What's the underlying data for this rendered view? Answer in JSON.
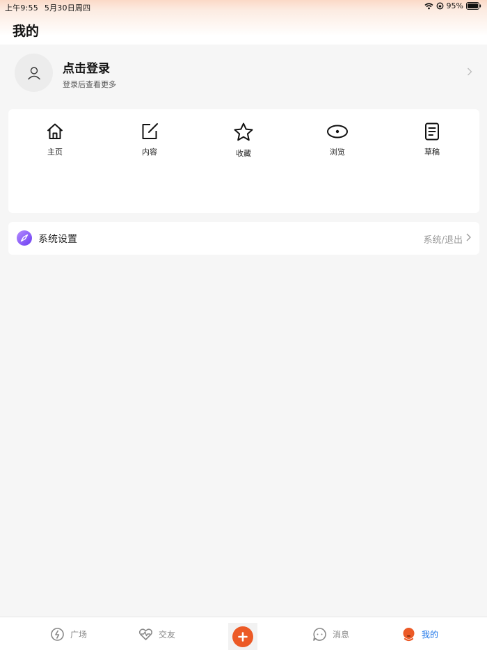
{
  "status_bar": {
    "time": "上午9:55",
    "date": "5月30日周四",
    "battery": "95%",
    "icons": [
      "wifi-icon",
      "orientation-lock-icon",
      "battery-icon"
    ]
  },
  "header": {
    "title": "我的"
  },
  "profile": {
    "title": "点击登录",
    "subtitle": "登录后查看更多",
    "avatar_icon": "user-icon"
  },
  "quick_actions": [
    {
      "label": "主页",
      "icon": "home-icon"
    },
    {
      "label": "内容",
      "icon": "edit-icon"
    },
    {
      "label": "收藏",
      "icon": "star-icon"
    },
    {
      "label": "浏览",
      "icon": "eye-icon"
    },
    {
      "label": "草稿",
      "icon": "draft-icon"
    }
  ],
  "settings": {
    "label": "系统设置",
    "value": "系统/退出",
    "icon": "compass-icon"
  },
  "tab_bar": {
    "items": [
      {
        "label": "广场",
        "icon": "plaza-icon",
        "active": false
      },
      {
        "label": "交友",
        "icon": "heart-pulse-icon",
        "active": false
      },
      {
        "label": "",
        "icon": "plus-icon",
        "active": false
      },
      {
        "label": "消息",
        "icon": "chat-icon",
        "active": false
      },
      {
        "label": "我的",
        "icon": "profile-icon",
        "active": true
      }
    ]
  },
  "colors": {
    "accent": "#ec5a26",
    "active_tab": "#1a73e8",
    "settings_icon": "#7a4bf5",
    "background": "#f6f6f6"
  }
}
